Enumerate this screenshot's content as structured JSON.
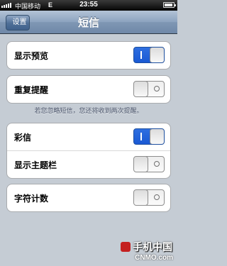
{
  "status_bar": {
    "carrier": "中国移动",
    "network": "E",
    "time": "23:55"
  },
  "nav": {
    "back_label": "设置",
    "title": "短信"
  },
  "settings": {
    "show_preview": {
      "label": "显示预览",
      "on": true
    },
    "repeat_alert": {
      "label": "重复提醒",
      "on": false
    },
    "repeat_note": "若您忽略短信，您还将收到两次提醒。",
    "mms": {
      "label": "彩信",
      "on": true
    },
    "subject_field": {
      "label": "显示主题栏",
      "on": false
    },
    "char_count": {
      "label": "字符计数",
      "on": false
    }
  },
  "watermark": {
    "cn": "手机中国",
    "en": "CNMO.com"
  }
}
